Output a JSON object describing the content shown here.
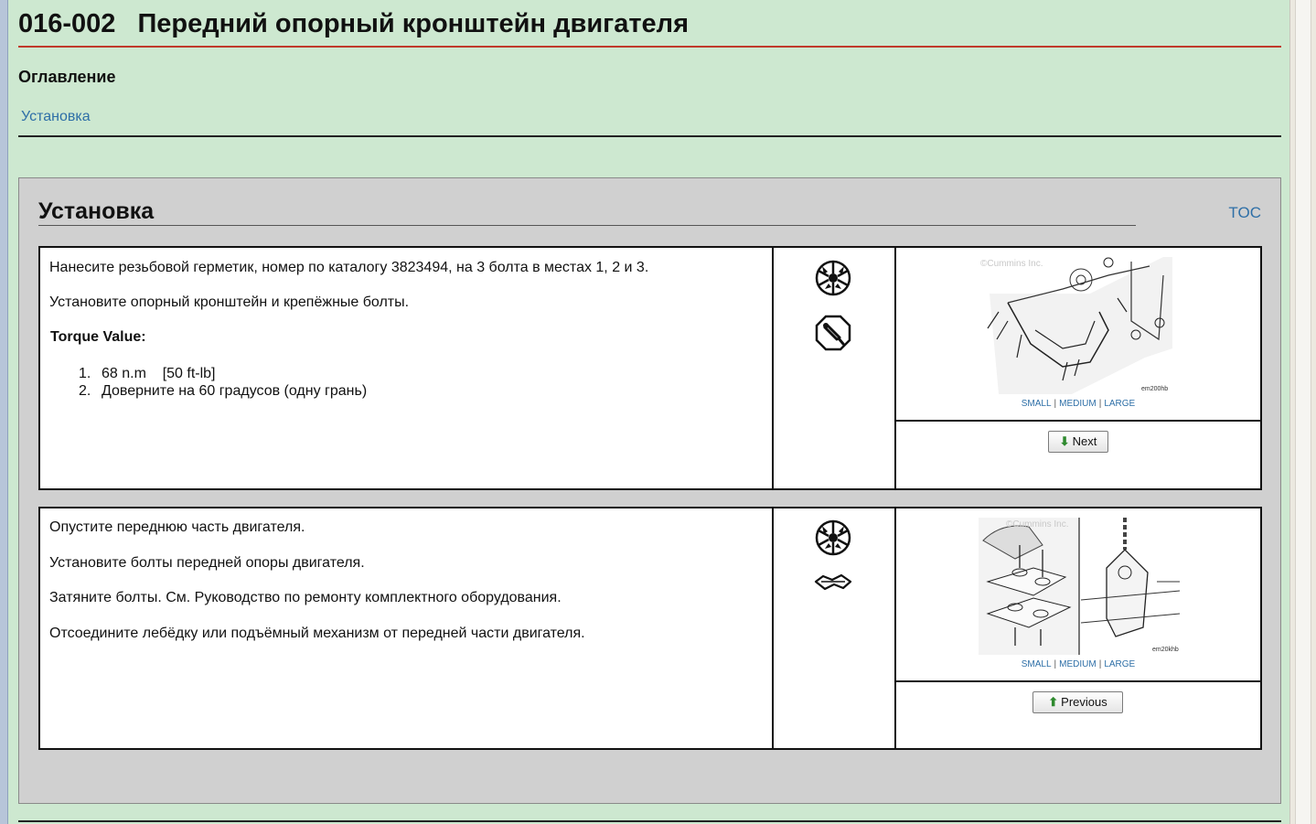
{
  "document": {
    "number": "016-002",
    "title": "Передний опорный кронштейн двигателя"
  },
  "toc": {
    "heading": "Оглавление",
    "links": [
      "Установка"
    ]
  },
  "section": {
    "title": "Установка",
    "toc_link": "TOC",
    "steps": [
      {
        "paragraphs": [
          "Нанесите резьбовой герметик, номер по каталогу 3823494, на 3 болта в местах 1, 2 и 3.",
          "Установите опорный кронштейн и крепёжные болты."
        ],
        "torque_label": "Torque Value:",
        "torque_items": [
          {
            "n": "1.",
            "text": "68 n.m    [50 ft-lb]"
          },
          {
            "n": "2.",
            "text": "Доверните на 60 градусов (одну грань)"
          }
        ],
        "icons": [
          "parts-wheel-icon",
          "sealant-tool-icon"
        ],
        "figure": {
          "copyright": "©Cummins Inc.",
          "code": "em200hb",
          "size_links": [
            "SMALL",
            "MEDIUM",
            "LARGE"
          ]
        },
        "nav_button": "Next",
        "nav_arrow": "⬇"
      },
      {
        "paragraphs": [
          "Опустите переднюю часть двигателя.",
          "Установите болты передней опоры двигателя.",
          "Затяните болты. См. Руководство по ремонту комплектного оборудования.",
          "Отсоедините лебёдку или подъёмный механизм от передней части двигателя."
        ],
        "icons": [
          "parts-wheel-icon",
          "wrench-icon"
        ],
        "figure": {
          "copyright": "©Cummins Inc.",
          "code": "em20khb",
          "size_links": [
            "SMALL",
            "MEDIUM",
            "LARGE"
          ]
        },
        "nav_button": "Previous",
        "nav_arrow": "⬆"
      }
    ]
  }
}
